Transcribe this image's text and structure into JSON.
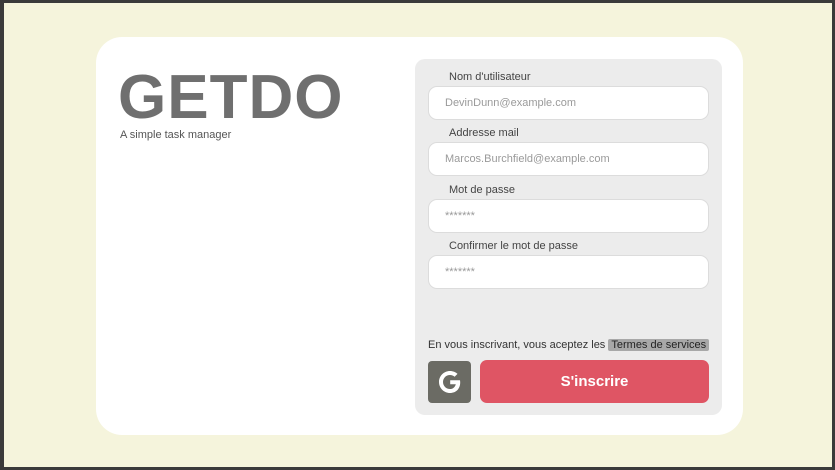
{
  "brand": {
    "title": "GETDO",
    "tagline": "A simple task manager"
  },
  "form": {
    "fields": [
      {
        "label": "Nom  d'utilisateur",
        "placeholder": "DevinDunn@example.com"
      },
      {
        "label": "Addresse mail",
        "placeholder": "Marcos.Burchfield@example.com"
      },
      {
        "label": "Mot de passe",
        "placeholder": "*******"
      },
      {
        "label": "Confirmer le mot de passe",
        "placeholder": "*******"
      }
    ],
    "terms_text": "En vous inscrivant, vous aceptez les",
    "terms_link": "Termes de services",
    "submit_label": "S'inscrire",
    "google_icon": "google-icon"
  },
  "colors": {
    "background": "#f5f4dc",
    "card": "#ffffff",
    "panel": "#ececec",
    "accent": "#df5564",
    "logo": "#6f6f6f",
    "google_button": "#6b6b64"
  }
}
